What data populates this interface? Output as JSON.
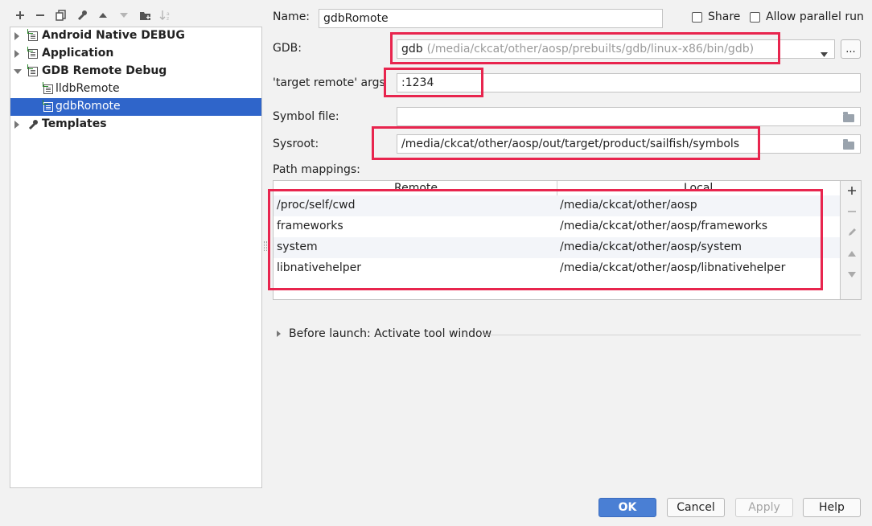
{
  "toolbar": {
    "icons": [
      "add-icon",
      "remove-icon",
      "copy-icon",
      "wrench-icon",
      "move-up-icon",
      "move-down-icon",
      "new-folder-icon",
      "sort-icon"
    ]
  },
  "tree": {
    "items": [
      {
        "label": "Android Native DEBUG",
        "bold": true
      },
      {
        "label": "Application",
        "bold": true
      },
      {
        "label": "GDB Remote Debug",
        "bold": true
      },
      {
        "label": "lldbRemote",
        "bold": false
      },
      {
        "label": "gdbRomote",
        "bold": false,
        "selected": true
      },
      {
        "label": "Templates",
        "bold": true
      }
    ]
  },
  "form": {
    "name_label": "Name:",
    "name_value": "gdbRomote",
    "share_label": "Share",
    "parallel_label": "Allow parallel run",
    "gdb_label": "GDB:",
    "gdb_value": "gdb",
    "gdb_path": "(/media/ckcat/other/aosp/prebuilts/gdb/linux-x86/bin/gdb)",
    "gdb_more_label": "...",
    "target_label": "'target remote' args",
    "target_value": ":1234",
    "symbol_label": "Symbol file:",
    "symbol_value": "",
    "sysroot_label": "Sysroot:",
    "sysroot_value": "/media/ckcat/other/aosp/out/target/product/sailfish/symbols",
    "path_mappings_label": "Path mappings:"
  },
  "path_mappings": {
    "headers": {
      "remote": "Remote",
      "local": "Local"
    },
    "rows": [
      {
        "remote": "/proc/self/cwd",
        "local": "/media/ckcat/other/aosp"
      },
      {
        "remote": "frameworks",
        "local": "/media/ckcat/other/aosp/frameworks"
      },
      {
        "remote": "system",
        "local": "/media/ckcat/other/aosp/system"
      },
      {
        "remote": "libnativehelper",
        "local": "/media/ckcat/other/aosp/libnativehelper"
      }
    ]
  },
  "before_launch": {
    "label": "Before launch: Activate tool window"
  },
  "buttons": {
    "ok": "OK",
    "cancel": "Cancel",
    "apply": "Apply",
    "help": "Help"
  },
  "colors": {
    "accent": "#2f65ca",
    "highlight": "#e8254e",
    "ok_button": "#4a7fd4"
  }
}
